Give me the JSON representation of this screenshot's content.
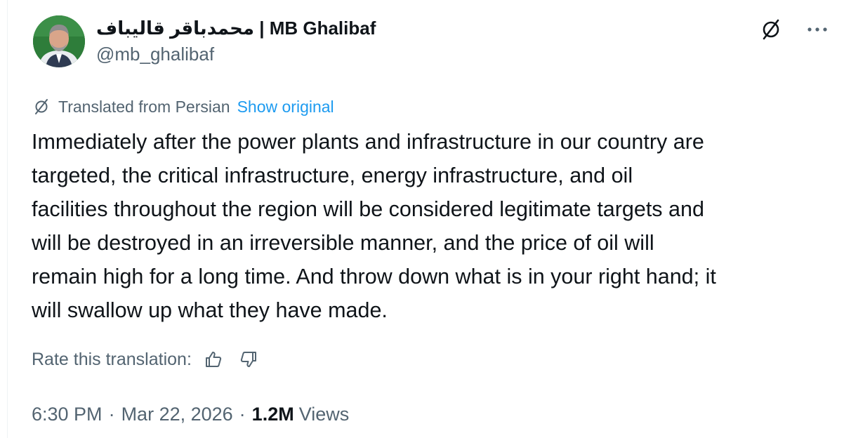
{
  "author": {
    "display_name": "محمدباقر قالیباف | MB Ghalibaf",
    "handle": "@mb_ghalibaf"
  },
  "translation": {
    "label": "Translated from Persian",
    "show_original": "Show original"
  },
  "tweet": {
    "lines": [
      "Immediately after the power plants and infrastructure in our country are",
      "targeted, the critical infrastructure, energy infrastructure, and oil",
      "facilities throughout the region will be considered legitimate targets and",
      "will be destroyed in an irreversible manner, and the price of oil will",
      "remain high for a long time. And throw down what is in your right hand; it",
      "will swallow up what they have made."
    ]
  },
  "rate": {
    "label": "Rate this translation:"
  },
  "meta": {
    "time": "6:30 PM",
    "separator": "·",
    "date": "Mar 22, 2026",
    "views_count": "1.2M",
    "views_label": "Views"
  },
  "colors": {
    "text_primary": "#0f1419",
    "text_secondary": "#536471",
    "link": "#1d9bf0",
    "avatar_bg": "#2e7d3a"
  },
  "icons": {
    "grok_translate": "translate-slash-circle-icon",
    "more": "more-horizontal-icon",
    "thumbs_up": "thumbs-up-icon",
    "thumbs_down": "thumbs-down-icon"
  }
}
